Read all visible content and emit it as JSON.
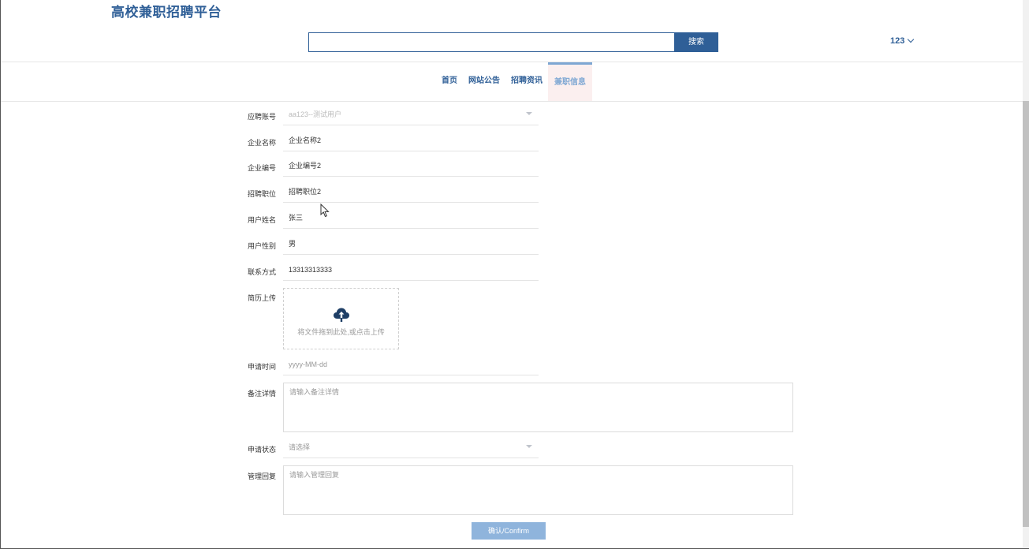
{
  "header": {
    "site_title": "高校兼职招聘平台",
    "search": {
      "value": "",
      "placeholder": "",
      "button_label": "搜索"
    },
    "user_menu_label": "123"
  },
  "nav": {
    "items": [
      {
        "label": "首页",
        "active": false
      },
      {
        "label": "网站公告",
        "active": false
      },
      {
        "label": "招聘资讯",
        "active": false
      },
      {
        "label": "兼职信息",
        "active": true
      }
    ]
  },
  "form": {
    "account": {
      "label": "应聘账号",
      "value": "aa123--测试用户"
    },
    "company_name": {
      "label": "企业名称",
      "value": "企业名称2"
    },
    "company_no": {
      "label": "企业编号",
      "value": "企业编号2"
    },
    "position": {
      "label": "招聘职位",
      "value": "招聘职位2"
    },
    "user_name": {
      "label": "用户姓名",
      "value": "张三"
    },
    "gender": {
      "label": "用户性别",
      "value": "男"
    },
    "contact": {
      "label": "联系方式",
      "value": "13313313333"
    },
    "resume": {
      "label": "简历上传",
      "hint": "将文件拖到此处,或点击上传"
    },
    "apply_time": {
      "label": "申请时间",
      "placeholder": "yyyy-MM-dd"
    },
    "remark": {
      "label": "备注详情",
      "placeholder": "请输入备注详情"
    },
    "status": {
      "label": "申请状态",
      "placeholder": "请选择"
    },
    "reply": {
      "label": "管理回复",
      "placeholder": "请输入管理回复"
    },
    "confirm_label": "确认/Confirm"
  },
  "colors": {
    "brand": "#2f5f97",
    "active_nav": "#7ea7d3",
    "confirm": "#8fb4dc"
  }
}
